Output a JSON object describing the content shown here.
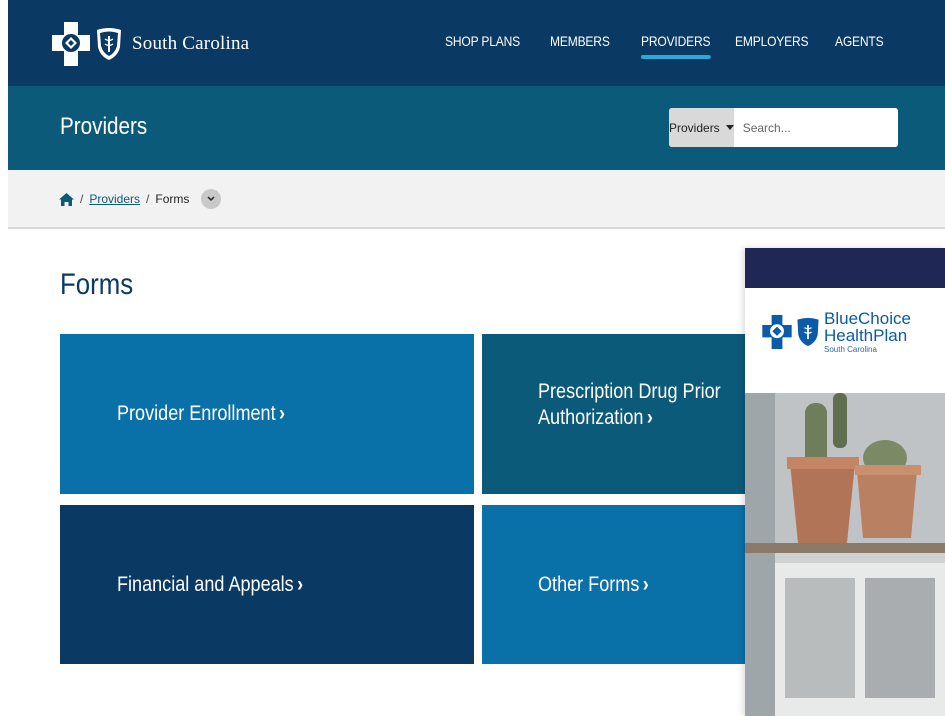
{
  "header": {
    "brand": "South Carolina",
    "nav": [
      {
        "label": "SHOP PLANS",
        "active": false
      },
      {
        "label": "MEMBERS",
        "active": false
      },
      {
        "label": "PROVIDERS",
        "active": true
      },
      {
        "label": "EMPLOYERS",
        "active": false
      },
      {
        "label": "AGENTS",
        "active": false
      }
    ]
  },
  "subheader": {
    "title": "Providers",
    "search": {
      "scope": "Providers",
      "placeholder": "Search..."
    }
  },
  "breadcrumb": {
    "items": [
      "Providers",
      "Forms"
    ],
    "separator": "/"
  },
  "main": {
    "title": "Forms",
    "tiles": [
      {
        "label": "Provider Enrollment",
        "color": "#0a70a8"
      },
      {
        "label_line1": "Prescription Drug Prior",
        "label_line2": "Authorization",
        "color": "#0b5a7a"
      },
      {
        "label": "Financial and Appeals",
        "color": "#0a3a64"
      },
      {
        "label": "Other Forms",
        "color": "#0a70a8"
      }
    ],
    "chevron": "›"
  },
  "promo": {
    "line1": "BlueChoice",
    "line2": "HealthPlan",
    "line3": "South Carolina",
    "bar_color": "#1f2755"
  },
  "colors": {
    "nav_bg": "#0a3a64",
    "subheader_bg": "#0b5a7a",
    "accent": "#2aa9d9"
  }
}
